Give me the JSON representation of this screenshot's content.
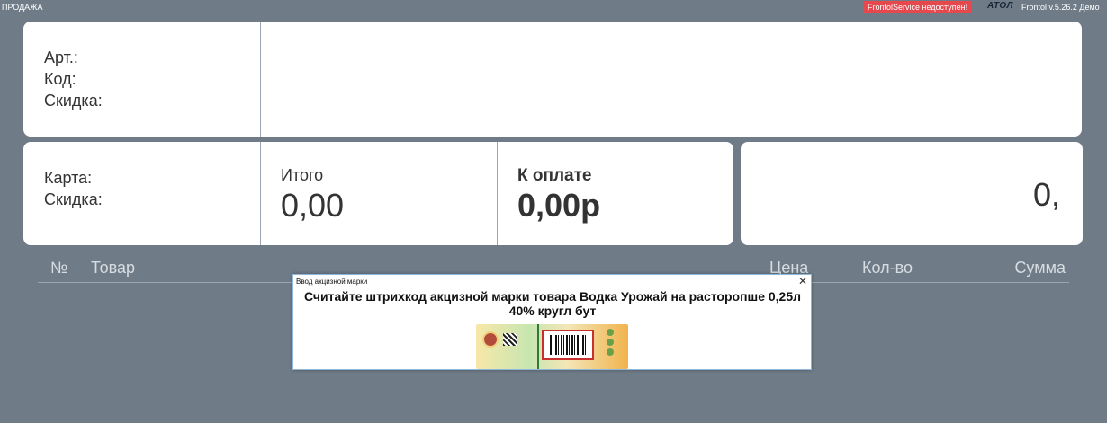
{
  "app": {
    "mode": "ПРОДАЖА",
    "service_warning": "FrontolService недоступен!",
    "logo": "ATOЛ",
    "version": "Frontol v.5.26.2 Демо"
  },
  "item_panel": {
    "article_label": "Арт.:",
    "code_label": "Код:",
    "discount_label": "Скидка:"
  },
  "summary": {
    "card_label": "Карта:",
    "card_discount_label": "Скидка:",
    "total_label": "Итого",
    "total_value": "0,00",
    "to_pay_label": "К оплате",
    "to_pay_value": "0,00р",
    "input_value": "0,"
  },
  "table": {
    "columns": {
      "num": "№",
      "item": "Товар",
      "price": "Цена",
      "qty": "Кол-во",
      "sum": "Сумма"
    }
  },
  "dialog": {
    "title": "Ввод акцизной марки",
    "close": "✕",
    "message": "Считайте штрихкод акцизной марки товара Водка Урожай на расторопше 0,25л 40% кругл бут"
  },
  "colors": {
    "background": "#6f7c88",
    "warning": "#e5484d",
    "panel": "#ffffff"
  }
}
